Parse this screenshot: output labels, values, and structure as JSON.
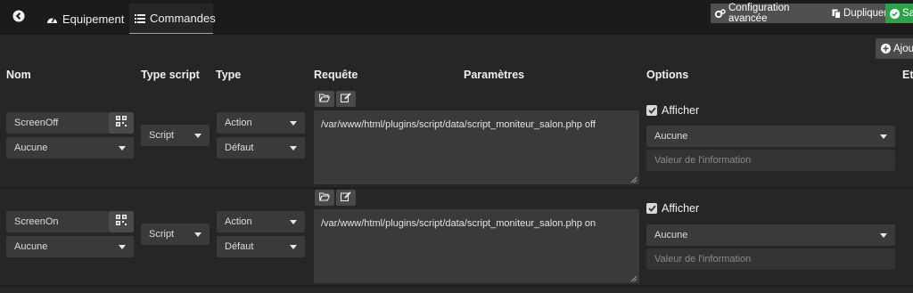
{
  "tabs": {
    "back_icon": "arrow-left-circle-icon",
    "equipement": "Equipement",
    "commandes": "Commandes"
  },
  "toolbar": {
    "config_avancee": "Configuration avancée",
    "dupliquer": "Dupliquer",
    "sauvegarder": "Sa",
    "ajouter": "Ajout"
  },
  "headers": {
    "nom": "Nom",
    "type_script": "Type script",
    "type": "Type",
    "requete": "Requête",
    "parametres": "Paramètres",
    "options": "Options",
    "etat": "Et"
  },
  "commands": [
    {
      "name": "ScreenOff",
      "generic_type": "Aucune",
      "type_script": "Script",
      "type": "Action",
      "subtype": "Défaut",
      "request": "/var/www/html/plugins/script/data/script_moniteur_salon.php off",
      "afficher_label": "Afficher",
      "afficher_checked": true,
      "info_select": "Aucune",
      "info_placeholder": "Valeur de l'information"
    },
    {
      "name": "ScreenOn",
      "generic_type": "Aucune",
      "type_script": "Script",
      "type": "Action",
      "subtype": "Défaut",
      "request": "/var/www/html/plugins/script/data/script_moniteur_salon.php on",
      "afficher_label": "Afficher",
      "afficher_checked": true,
      "info_select": "Aucune",
      "info_placeholder": "Valeur de l'information"
    }
  ],
  "colors": {
    "accent_green": "#8fc23a",
    "save_green": "#2ea24a",
    "background": "#262626"
  }
}
